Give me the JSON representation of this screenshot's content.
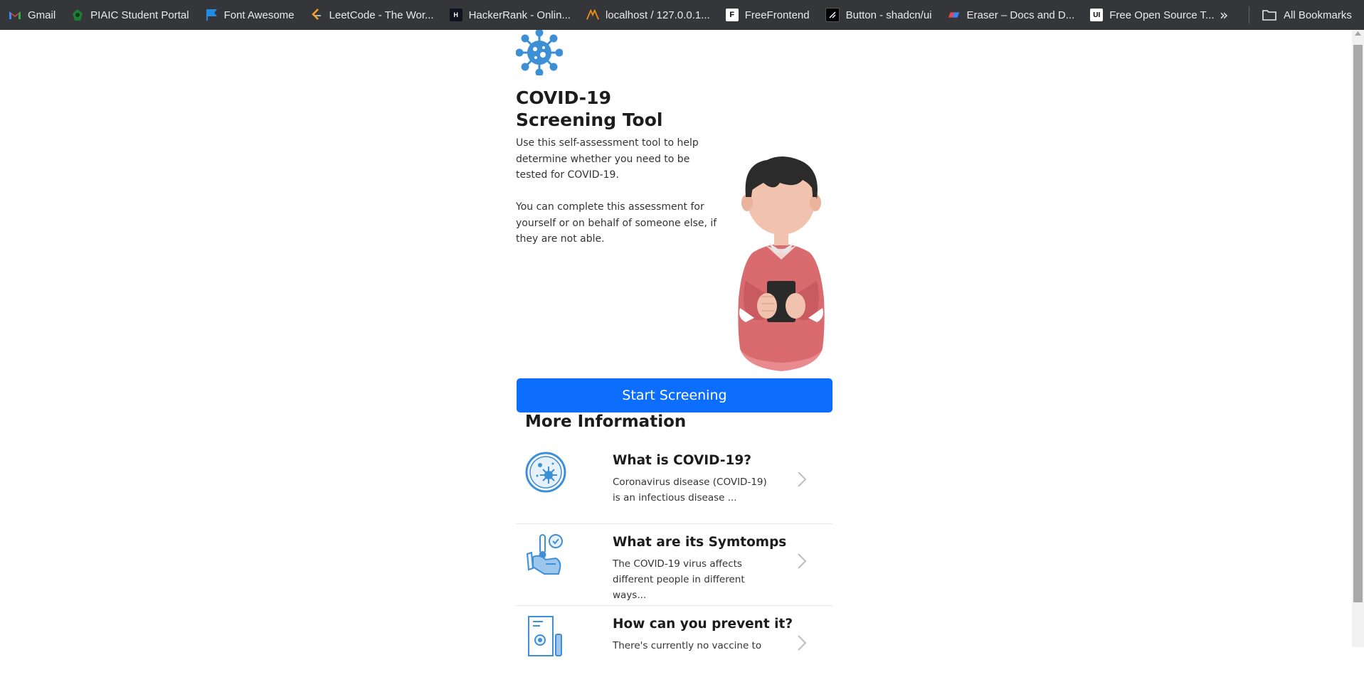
{
  "bookmarks": [
    {
      "label": "Gmail",
      "icon": "gmail-icon",
      "color": "#ea4335"
    },
    {
      "label": "PIAIC Student Portal",
      "icon": "piaic-icon",
      "color": "#1e7e34"
    },
    {
      "label": "Font Awesome",
      "icon": "flag-icon",
      "color": "#228be6"
    },
    {
      "label": "LeetCode - The Wor...",
      "icon": "leetcode-icon",
      "color": "#ffa116"
    },
    {
      "label": "HackerRank - Onlin...",
      "icon": "hackerrank-icon",
      "color": "#00ea64"
    },
    {
      "label": "localhost / 127.0.0.1...",
      "icon": "phpmyadmin-icon",
      "color": "#f29111"
    },
    {
      "label": "FreeFrontend",
      "icon": "freefrontend-icon",
      "color": "#ffffff"
    },
    {
      "label": "Button - shadcn/ui",
      "icon": "shadcn-icon",
      "color": "#000000"
    },
    {
      "label": "Eraser – Docs and D...",
      "icon": "eraser-icon",
      "color": "#e5484d"
    },
    {
      "label": "Free Open Source T...",
      "icon": "ui-icon",
      "color": "#ffffff"
    }
  ],
  "bookmarks_more": "»",
  "all_bookmarks": "All Bookmarks",
  "page": {
    "title_line1": "COVID-19",
    "title_line2": "Screening Tool",
    "desc1": "Use this self-assessment tool to help determine whether you need to be tested for COVID-19.",
    "desc2": "You can complete this assessment for yourself or on behalf of someone else, if they are not able.",
    "start_button": "Start Screening",
    "more_info_title": "More Information",
    "accent": "#0d6efd",
    "icon_blue": "#3d8fd6"
  },
  "info_items": [
    {
      "title": "What is COVID-19?",
      "text": "Coronavirus disease (COVID-19) is an infectious disease ...",
      "icon": "virus-circle-icon"
    },
    {
      "title": "What are its Symtomps",
      "text": "The COVID-19 virus affects different people in different ways...",
      "icon": "symptoms-icon"
    },
    {
      "title": "How can you prevent it?",
      "text": "There's currently no vaccine to",
      "icon": "prevention-icon"
    }
  ]
}
